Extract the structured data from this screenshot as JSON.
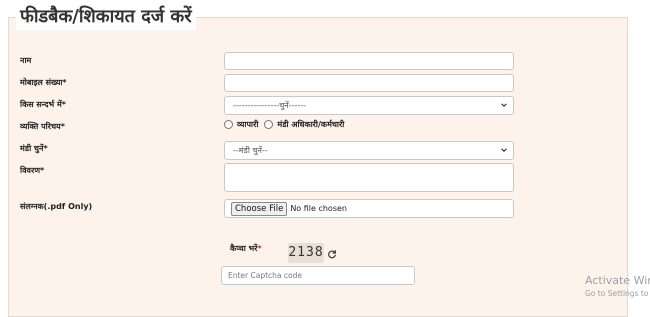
{
  "form": {
    "title": "फीडबैक/शिकायत दर्ज करें",
    "fields": {
      "name_label": "नाम",
      "mobile_label": "मोबाइल संख्या*",
      "context_label": "किस सन्दर्भ में*",
      "context_value": "----------------चुनें------",
      "person_type_label": "व्यक्ति परिचय*",
      "person_option_1": "व्यापारी",
      "person_option_2": "मंडी अधिकारी/कर्मचारी",
      "mandi_label": "मंडी चुनें*",
      "mandi_value": "--मंडी चुनें--",
      "description_label": "विवरण*",
      "attachment_label": "संलग्नक(.pdf Only)",
      "choose_file": "Choose File",
      "no_file": "No file chosen"
    },
    "captcha": {
      "label": "कैप्चा भरें",
      "required_mark": "*",
      "code": "2138",
      "placeholder": "Enter Captcha code"
    }
  },
  "watermark": {
    "line1": "Activate Wind",
    "line2": "Go to Settings to a"
  },
  "icons": {
    "select_arrow": "chevron-down-icon",
    "refresh": "refresh-icon"
  }
}
